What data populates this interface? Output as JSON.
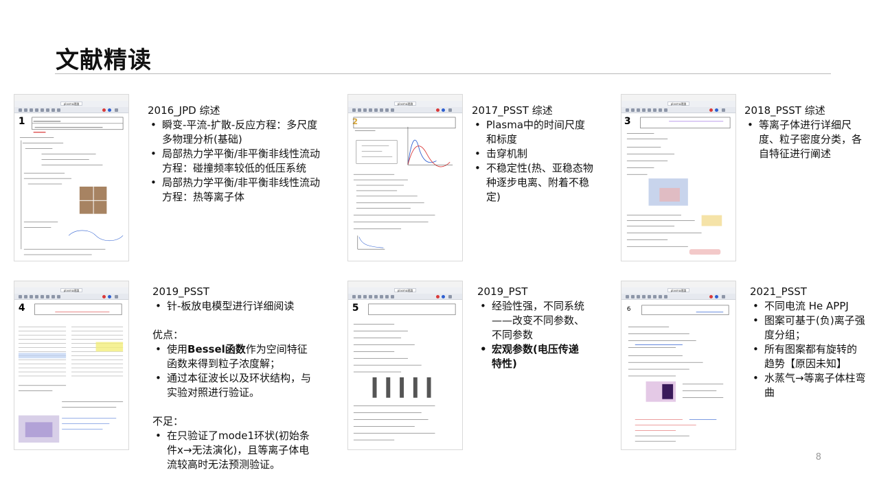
{
  "slide": {
    "title": "文献精读",
    "page_number": "8"
  },
  "entries": [
    {
      "heading": "2016_JPD 综述",
      "bullets": [
        "瞬变-平流-扩散-反应方程：多尺度多物理分析(基础)",
        "局部热力学平衡/非平衡非线性流动方程：碰撞频率较低的低压系统",
        "局部热力学平衡/非平衡非线性流动方程：热等离子体"
      ]
    },
    {
      "heading": "2017_PSST 综述",
      "bullets": [
        "Plasma中的时间尺度和标度",
        "击穿机制",
        "不稳定性(热、亚稳态物种逐步电离、附着不稳定)"
      ]
    },
    {
      "heading": "2018_PSST 综述",
      "bullets": [
        "等离子体进行详细尺度、粒子密度分类，各自特征进行阐述"
      ]
    },
    {
      "heading": "2019_PSST",
      "bullets": [
        "针-板放电模型进行详细阅读"
      ],
      "pros_label": "优点：",
      "pros": [
        {
          "pre": "使用",
          "bold": "Bessel函数",
          "post": "作为空间特征函数来得到粒子浓度解；"
        },
        {
          "pre": "通过本征波长以及环状结构，与实验对照进行验证。",
          "bold": "",
          "post": ""
        }
      ],
      "cons_label": "不足：",
      "cons": [
        "在只验证了mode1环状(初始条件x→无法演化)，且等离子体电流较高时无法预测验证。"
      ]
    },
    {
      "heading": "2019_PST",
      "bullets": [
        "经验性强，不同系统——改变不同参数、不同参数"
      ],
      "bold_bullets": [
        "宏观参数(电压传递特性)"
      ]
    },
    {
      "heading": "2021_PSST",
      "bullets": [
        "不同电流 He APPJ",
        "图案可基于(负)离子强度分组；",
        "所有图案都有旋转的趋势【原因未知】",
        "水蒸气→等离子体柱弯曲"
      ]
    }
  ],
  "thumbnails": [
    {
      "number": "1",
      "tab": "plasma理論",
      "accent": "#d93a3a"
    },
    {
      "number": "2",
      "tab": "plasma理論",
      "accent": "#d9a83a"
    },
    {
      "number": "3",
      "tab": "plasma理論",
      "accent": "#7a3ad9"
    },
    {
      "number": "4",
      "tab": "plasma理論",
      "accent": "#2e5fd0"
    },
    {
      "number": "5",
      "tab": "plasma理論",
      "accent": "#2e5fd0"
    },
    {
      "number": "6",
      "tab": "plasma理論",
      "accent": "#2e5fd0"
    }
  ]
}
